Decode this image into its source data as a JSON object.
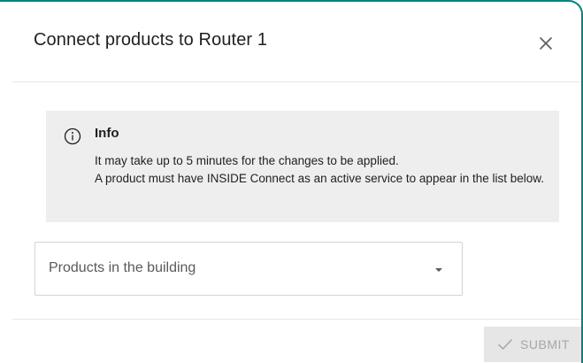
{
  "dialog": {
    "title": "Connect products to Router 1",
    "close_icon": "close-icon"
  },
  "info": {
    "icon": "info-icon",
    "title": "Info",
    "lines": [
      "It may take up to 5 minutes for the changes to be applied.",
      "A product must have INSIDE Connect as an active service to appear in the list below."
    ]
  },
  "products_select": {
    "label": "Products in the building",
    "caret_icon": "caret-down-icon"
  },
  "footer": {
    "submit_label": "SUBMIT",
    "submit_icon": "check-icon",
    "submit_disabled": true
  },
  "colors": {
    "accent": "#00857c",
    "info_bg": "#eeeeee",
    "button_disabled_bg": "#e6e6e6",
    "button_disabled_text": "#a6a6a6"
  }
}
